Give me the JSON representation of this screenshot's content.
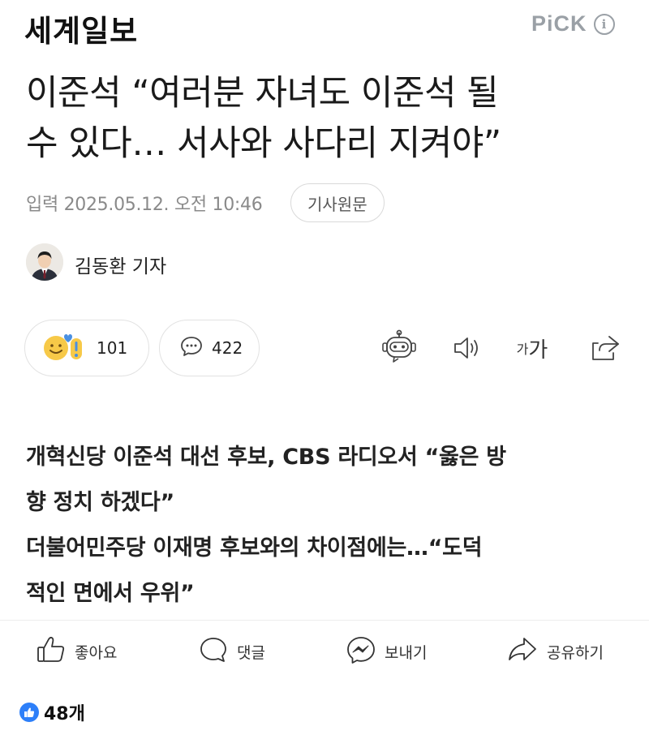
{
  "header": {
    "logo_text": "세계일보",
    "pick_label": "PiCK",
    "info_label": "i"
  },
  "article": {
    "headline_lines": [
      "이준석 “여러분 자녀도 이준석 될",
      "수 있다… 서사와 사다리 지켜야”"
    ],
    "published_label": "입력",
    "published_datetime": "2025.05.12. 오전 10:46",
    "original_button": "기사원문",
    "reporter": "김동환 기자"
  },
  "reactions": {
    "emotion_count": "101",
    "comment_count": "422"
  },
  "tools": {
    "font_small": "가",
    "font_large": "가"
  },
  "summary_lines": [
    "개혁신당 이준석 대선 후보, CBS 라디오서 “옳은 방",
    "향 정치 하겠다”",
    "더불어민주당 이재명 후보와의 차이점에는…“도덕",
    "적인 면에서 우위”"
  ],
  "actions": {
    "like": "좋아요",
    "comment": "댓글",
    "send": "보내기",
    "share": "공유하기"
  },
  "likes_total": "48개",
  "colors": {
    "gray_text": "#8a8a8a",
    "border": "#e2e2e2",
    "like_blue": "#2d7ff9",
    "react_yellow": "#f7c948",
    "react_blue": "#4a90e2"
  }
}
